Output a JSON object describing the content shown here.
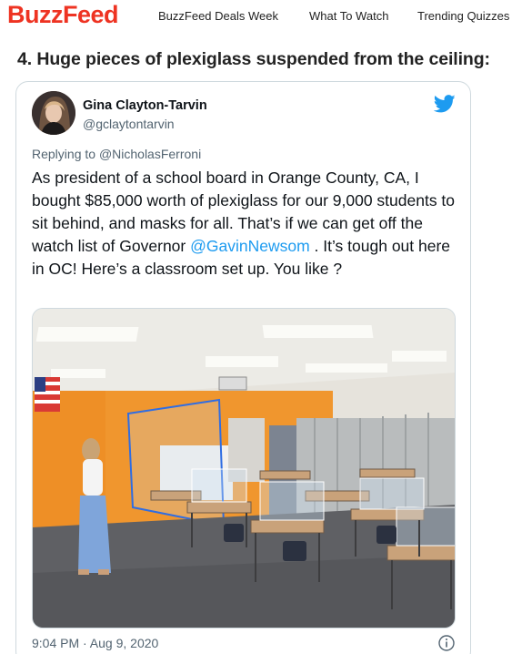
{
  "header": {
    "logo": "BuzzFeed",
    "nav": [
      "BuzzFeed Deals Week",
      "What To Watch",
      "Trending Quizzes"
    ]
  },
  "article": {
    "headline": "4. Huge pieces of plexiglass suspended from the ceiling:"
  },
  "tweet": {
    "author_name": "Gina Clayton-Tarvin",
    "author_handle": "@gclaytontarvin",
    "replying_prefix": "Replying to",
    "replying_to": "@NicholasFerroni",
    "text_before_link": "As president of a school board in Orange County, CA, I bought $85,000 worth of plexiglass for our 9,000 students to sit behind, and masks for all. That’s if we can get off the watch list of Governor ",
    "link_text": "@GavinNewsom",
    "text_after_link": " . It’s tough out here in OC! Here’s a classroom set up. You like ?",
    "timestamp": "9:04 PM · Aug 9, 2020",
    "icons": {
      "brand": "twitter-bird-icon",
      "info": "info-icon"
    }
  },
  "colors": {
    "brand_red": "#ee3322",
    "twitter_blue": "#1d9bf0",
    "muted": "#536471"
  }
}
